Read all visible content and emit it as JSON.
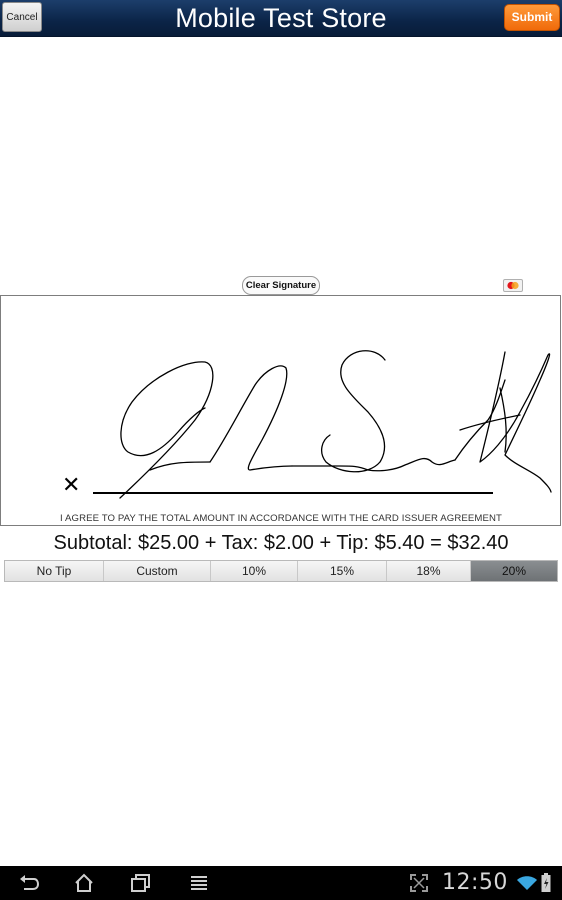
{
  "header": {
    "title": "Mobile Test Store",
    "cancel_label": "Cancel",
    "submit_label": "Submit"
  },
  "signature": {
    "clear_label": "Clear Signature",
    "card_icon": "mastercard-icon",
    "x_mark": "✕",
    "agreement": "I AGREE TO PAY THE TOTAL AMOUNT IN ACCORDANCE WITH THE CARD ISSUER AGREEMENT"
  },
  "totals": {
    "text": "Subtotal: $25.00 + Tax: $2.00 + Tip: $5.40 = $32.40"
  },
  "tips": {
    "options": [
      "No Tip",
      "Custom",
      "10%",
      "15%",
      "18%",
      "20%"
    ],
    "selected": "20%"
  },
  "system_bar": {
    "clock": "12:50",
    "icons": [
      "back-icon",
      "home-icon",
      "recent-apps-icon",
      "menu-icon",
      "screenshot-expand-icon",
      "wifi-icon",
      "battery-icon"
    ]
  },
  "colors": {
    "header_bg": "#0b2447",
    "submit_bg": "#f57c1f",
    "selected_tip_bg": "#7a7e81",
    "nav_bg": "#000000"
  }
}
